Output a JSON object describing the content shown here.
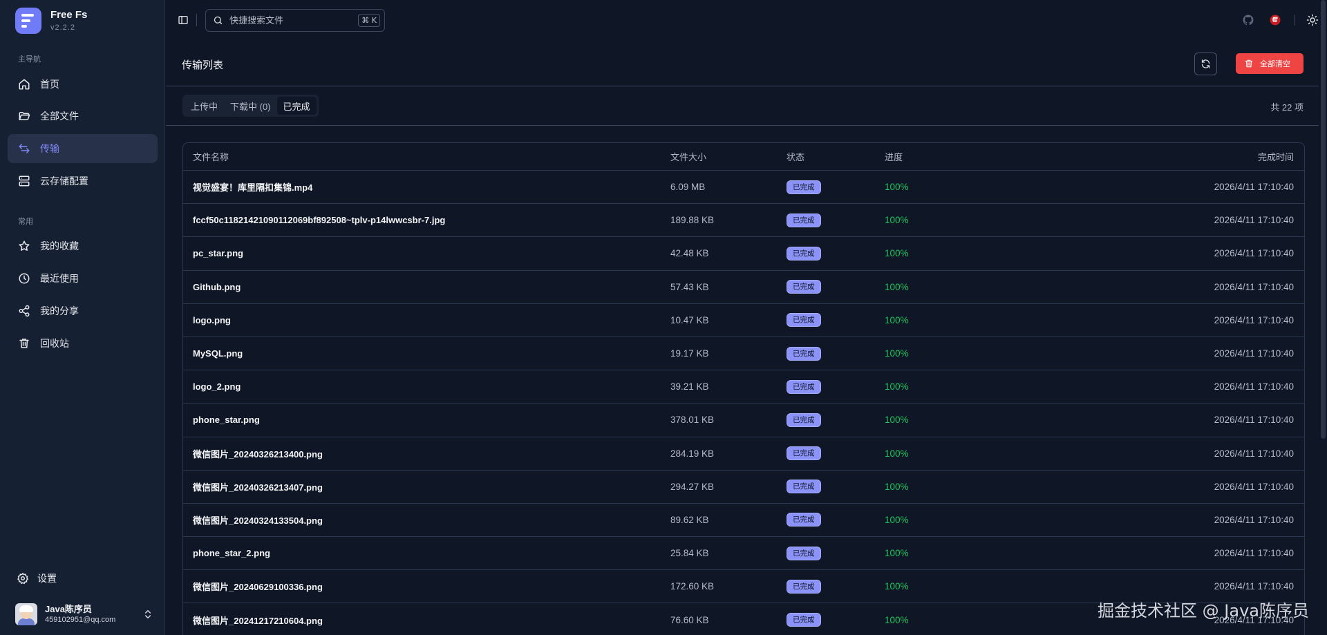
{
  "app": {
    "name": "Free Fs",
    "version": "v2.2.2"
  },
  "sidebar": {
    "main_label": "主导航",
    "main_items": [
      {
        "label": "首页",
        "icon": "home-icon"
      },
      {
        "label": "全部文件",
        "icon": "folder-icon"
      },
      {
        "label": "传输",
        "icon": "transfer-icon",
        "active": true
      },
      {
        "label": "云存储配置",
        "icon": "storage-icon"
      }
    ],
    "common_label": "常用",
    "common_items": [
      {
        "label": "我的收藏",
        "icon": "star-icon"
      },
      {
        "label": "最近使用",
        "icon": "clock-icon"
      },
      {
        "label": "我的分享",
        "icon": "share-icon"
      },
      {
        "label": "回收站",
        "icon": "trash-icon"
      }
    ],
    "settings_label": "设置",
    "user": {
      "name": "Java陈序员",
      "email": "459102951@qq.com"
    }
  },
  "topbar": {
    "search_placeholder": "快捷搜索文件",
    "shortcut": "⌘ K"
  },
  "page": {
    "title": "传输列表",
    "clear_all_label": "全部清空",
    "tabs": [
      {
        "label": "上传中"
      },
      {
        "label": "下载中 (0)"
      },
      {
        "label": "已完成",
        "active": true
      }
    ],
    "total_text": "共 22 项"
  },
  "table": {
    "headers": {
      "name": "文件名称",
      "size": "文件大小",
      "status": "状态",
      "progress": "进度",
      "time": "完成时间"
    },
    "rows": [
      {
        "name": "视觉盛宴！库里隔扣集锦.mp4",
        "size": "6.09 MB",
        "status": "已完成",
        "progress": "100%",
        "time": "2026/4/11 17:10:40"
      },
      {
        "name": "fccf50c11821421090112069bf892508~tplv-p14lwwcsbr-7.jpg",
        "size": "189.88 KB",
        "status": "已完成",
        "progress": "100%",
        "time": "2026/4/11 17:10:40"
      },
      {
        "name": "pc_star.png",
        "size": "42.48 KB",
        "status": "已完成",
        "progress": "100%",
        "time": "2026/4/11 17:10:40"
      },
      {
        "name": "Github.png",
        "size": "57.43 KB",
        "status": "已完成",
        "progress": "100%",
        "time": "2026/4/11 17:10:40"
      },
      {
        "name": "logo.png",
        "size": "10.47 KB",
        "status": "已完成",
        "progress": "100%",
        "time": "2026/4/11 17:10:40"
      },
      {
        "name": "MySQL.png",
        "size": "19.17 KB",
        "status": "已完成",
        "progress": "100%",
        "time": "2026/4/11 17:10:40"
      },
      {
        "name": "logo_2.png",
        "size": "39.21 KB",
        "status": "已完成",
        "progress": "100%",
        "time": "2026/4/11 17:10:40"
      },
      {
        "name": "phone_star.png",
        "size": "378.01 KB",
        "status": "已完成",
        "progress": "100%",
        "time": "2026/4/11 17:10:40"
      },
      {
        "name": "微信图片_20240326213400.png",
        "size": "284.19 KB",
        "status": "已完成",
        "progress": "100%",
        "time": "2026/4/11 17:10:40"
      },
      {
        "name": "微信图片_20240326213407.png",
        "size": "294.27 KB",
        "status": "已完成",
        "progress": "100%",
        "time": "2026/4/11 17:10:40"
      },
      {
        "name": "微信图片_20240324133504.png",
        "size": "89.62 KB",
        "status": "已完成",
        "progress": "100%",
        "time": "2026/4/11 17:10:40"
      },
      {
        "name": "phone_star_2.png",
        "size": "25.84 KB",
        "status": "已完成",
        "progress": "100%",
        "time": "2026/4/11 17:10:40"
      },
      {
        "name": "微信图片_20240629100336.png",
        "size": "172.60 KB",
        "status": "已完成",
        "progress": "100%",
        "time": "2026/4/11 17:10:40"
      },
      {
        "name": "微信图片_20241217210604.png",
        "size": "76.60 KB",
        "status": "已完成",
        "progress": "100%",
        "time": "2026/4/11 17:10:40"
      }
    ]
  },
  "watermark": "掘金技术社区 @ Java陈序员",
  "colors": {
    "accent": "#6f7bf7",
    "danger": "#ef4444",
    "success": "#22c55e",
    "badge": "#8b93f8"
  }
}
